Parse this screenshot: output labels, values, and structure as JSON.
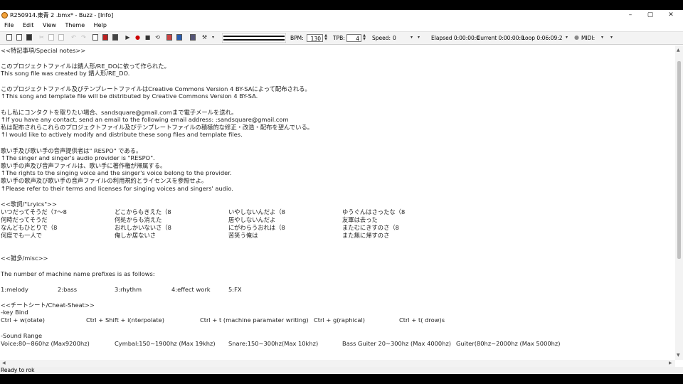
{
  "window": {
    "title": "R250914.東青 2 .bmx* - Buzz - [Info]",
    "minimize": "–",
    "maximize": "▢",
    "close": "✕"
  },
  "menu": [
    "File",
    "Edit",
    "View",
    "Theme",
    "Help"
  ],
  "toolbar": {
    "bpm_label": "BPM:",
    "bpm_value": "130",
    "tpb_label": "TPB:",
    "tpb_value": "4",
    "speed_label": "Speed:",
    "speed_value": "0",
    "elapsed": "Elapsed 0:00:00:0",
    "current": "Current 0:00:00:0",
    "loop": "Loop 0:06:09:2",
    "midi": "MIDI:"
  },
  "content": {
    "lines": [
      "<<特記事項/Special notes>>",
      "",
      "このプロジェクトファイルは錆人形/RE_DOに依って作られた。",
      "This song file was created by 錆人形/RE_DO.",
      "",
      "このプロジェクトファイル及びテンプレートファイルはCreative Commons Version 4 BY-SAによって配布される。",
      "↑This song and template file will be distributed by Creative Commons Version 4 BY-SA.",
      "",
      "もし私にコンタクトを取りたい場合、sandsquare@gmail.comまで電子メールを送れ。",
      "↑If you have any contact, send an email to the following email address: :sandsquare@gmail.com",
      "私は配布されらこれらのプロジェクトファイル及びテンプレートファイルの積極的な修正・改造・配布を望んでいる。",
      "↑I would like to actively modify and distribute these song files and template files.",
      "",
      "歌い手及び歌い手の音声提供者は\" RESPO\" である。",
      "↑The singer and singer's audio provider is \"RESPO\".",
      "歌い手の声及び音声ファイルは、歌い手に著作権が帰属する。",
      "↑The rights to the singing voice and the singer's voice belong to the provider.",
      "歌い手の歌声及び歌い手の音声ファイルの利用規約とライセンスを参照せよ。",
      "↑Please refer to their terms and licenses for singing voices and singers' audio.",
      "",
      "<<歌詞/\"Lryics\">>"
    ],
    "lyrics": [
      [
        "いつだってそうだ（7〜8",
        "どこからもきえた（8",
        "いやしないんだよ（8",
        "ゆうぐんはさったな（8"
      ],
      [
        "何時だってそうだ",
        "何処からも消えた",
        "居やしないんだよ",
        "友軍は去った"
      ],
      [
        "なんどもひとりで（8",
        "おれしかいないさ（8",
        "にがわらうおれは（8",
        "またむにきすのさ（8"
      ],
      [
        "何度でも一人で",
        "俺しか居ないさ",
        "苦笑う俺は",
        "また無に帰すのさ"
      ]
    ],
    "misc_title": "<<雑多/misc>>",
    "prefix_text": "The number of machine name prefixes is as follows:",
    "prefixes": [
      "1:melody",
      "2:bass",
      "3:rhythm",
      "4:effect work",
      "5:FX"
    ],
    "cheat_title": "<<チートシート/Cheat-Sheat>>",
    "keybind_title": "-key Bind",
    "keybinds": [
      "Ctrl + w(otate)",
      "Ctrl + Shift + i(nterpolate)",
      "Ctrl + t (machine paramater writing)",
      "Ctrl + g(raphical)",
      "Ctrl + t( drow)s"
    ],
    "range_title": "-Sound Range",
    "ranges": [
      "Voice:80~860hz (Max9200hz)",
      "Cymbal:150~1900hz (Max 19khz)",
      "Snare:150~300hz(Max 10khz)",
      "Bass Guiter 20~300hz (Max 4000hz)",
      "Guiter(80hz~2000hz (Max 5000hz)"
    ]
  },
  "status": {
    "text": "Ready to rok"
  }
}
